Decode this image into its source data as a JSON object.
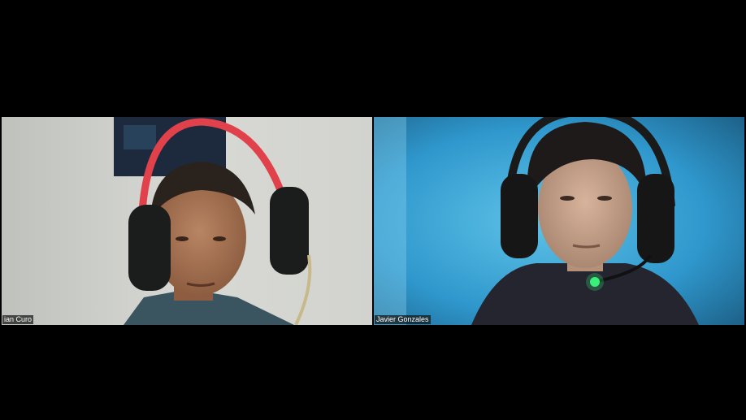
{
  "meeting": {
    "participants": [
      {
        "name": "ian Curo"
      },
      {
        "name": "Javier Gonzales"
      }
    ]
  },
  "colors": {
    "background": "#000000",
    "left_wall": "#cfd0cb",
    "right_backdrop": "#3fa9d9",
    "headset_accent": "#e0414b",
    "mic_led": "#38f07a"
  }
}
